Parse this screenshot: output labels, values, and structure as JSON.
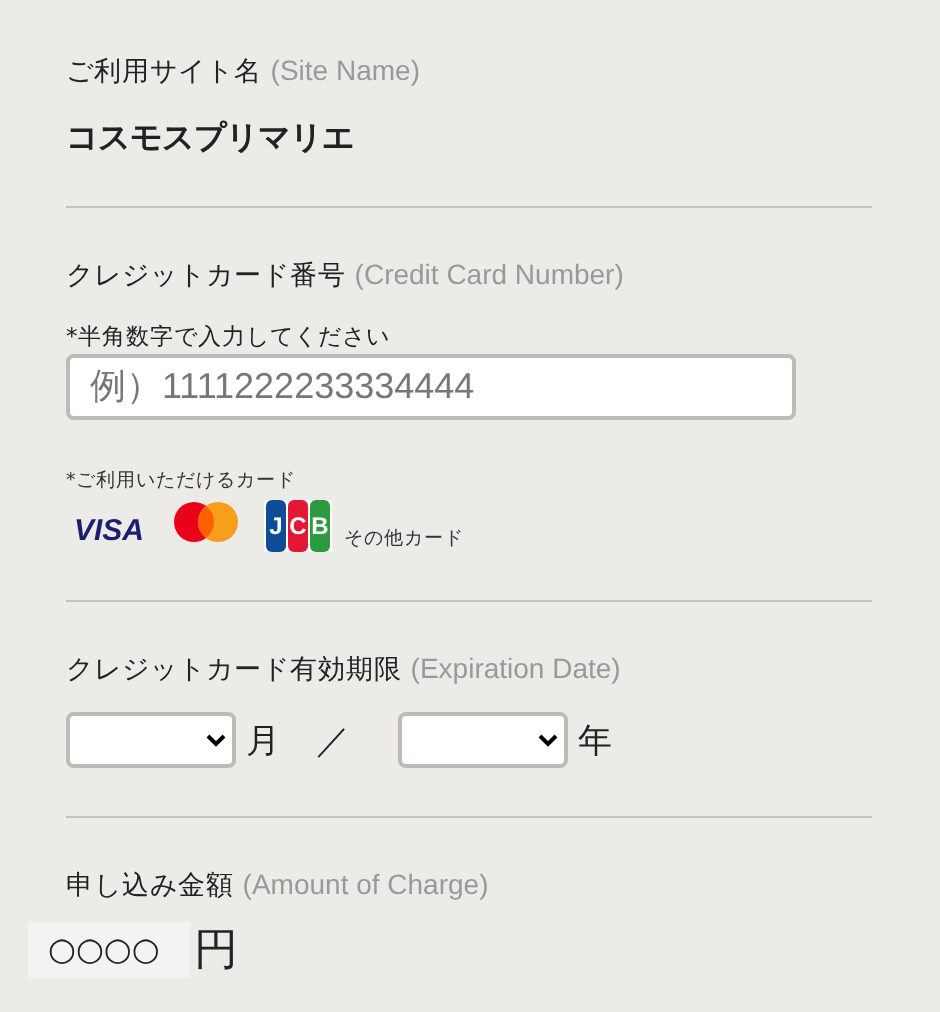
{
  "site": {
    "label": "ご利用サイト名",
    "label_en": "(Site Name)",
    "name": "コスモスプリマリエ"
  },
  "card_number": {
    "label": "クレジットカード番号",
    "label_en": "(Credit Card Number)",
    "hint": "*半角数字で入力してください",
    "placeholder": "例）1111222233334444"
  },
  "brands": {
    "label": "*ご利用いただけるカード",
    "items": [
      {
        "kind": "visa",
        "text": "VISA"
      },
      {
        "kind": "mastercard"
      },
      {
        "kind": "jcb",
        "text": "JCB"
      }
    ],
    "other": "その他カード"
  },
  "expiry": {
    "label": "クレジットカード有効期限",
    "label_en": "(Expiration Date)",
    "month_unit": "月",
    "separator": "／",
    "year_unit": "年"
  },
  "amount": {
    "label": "申し込み金額",
    "label_en": "(Amount of Charge)",
    "value": "○○○○",
    "unit": "円"
  }
}
